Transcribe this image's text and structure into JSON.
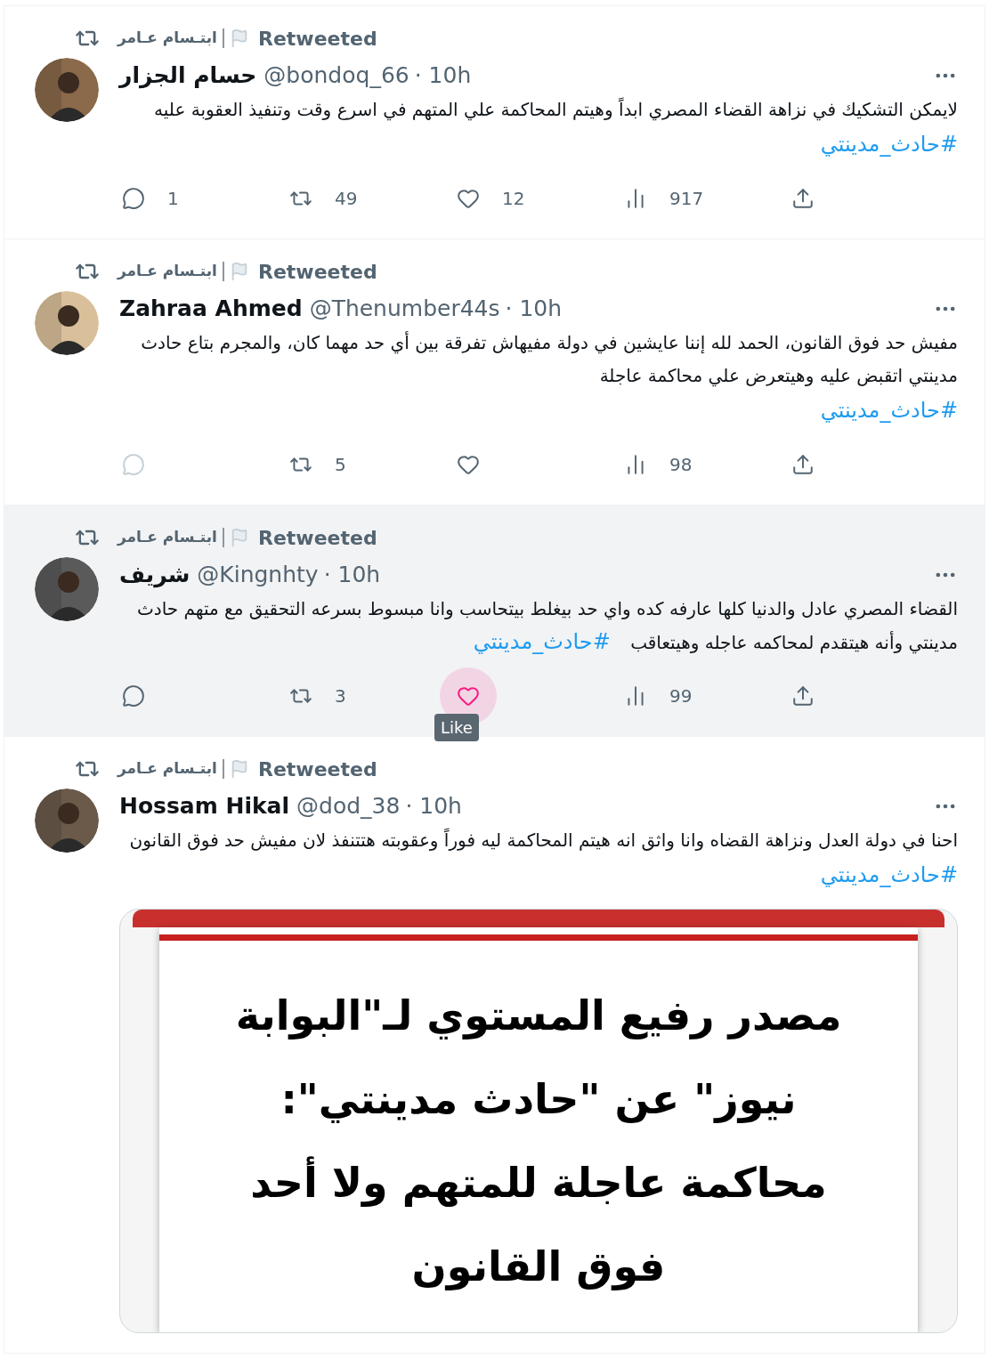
{
  "tweets": [
    {
      "retweeted_by": "ابتـسام عـامر",
      "retweet_label": "Retweeted",
      "name": "حسام الجزار",
      "handle": "@bondoq_66",
      "time": "· 10h",
      "text": "لايمكن التشكيك في نزاهة القضاء المصري ابداً وهيتم المحاكمة علي المتهم في اسرع وقت وتنفيذ العقوبة عليه",
      "hashtag": "#حادث_مدينتي",
      "hashtag_inline": false,
      "highlighted": false,
      "actions": {
        "reply": {
          "count": "1",
          "disabled": false,
          "hovered": false
        },
        "retweet": {
          "count": "49",
          "disabled": false,
          "hovered": false
        },
        "like": {
          "count": "12",
          "disabled": false,
          "hovered": false
        },
        "views": {
          "count": "917",
          "disabled": false,
          "hovered": false
        },
        "share": {
          "disabled": false,
          "hovered": false
        }
      }
    },
    {
      "retweeted_by": "ابتـسام عـامر",
      "retweet_label": "Retweeted",
      "name": "Zahraa Ahmed",
      "handle": "@Thenumber44s",
      "time": "· 10h",
      "text": "مفيش حد فوق القانون، الحمد لله إننا عايشين في دولة مفيهاش تفرقة بين أي حد مهما كان، والمجرم بتاع حادث مدينتي اتقبض عليه وهيتعرض علي محاكمة عاجلة",
      "hashtag": "#حادث_مدينتي",
      "hashtag_inline": false,
      "highlighted": false,
      "actions": {
        "reply": {
          "disabled": true,
          "hovered": false
        },
        "retweet": {
          "count": "5",
          "disabled": false,
          "hovered": false
        },
        "like": {
          "disabled": false,
          "hovered": false
        },
        "views": {
          "count": "98",
          "disabled": false,
          "hovered": false
        },
        "share": {
          "disabled": false,
          "hovered": false
        }
      }
    },
    {
      "retweeted_by": "ابتـسام عـامر",
      "retweet_label": "Retweeted",
      "name": "شريف",
      "handle": "@Kingnhty",
      "time": "· 10h",
      "text": "القضاء المصري عادل والدنيا كلها عارفه كده واي حد بيغلط بيتحاسب وانا مبسوط بسرعه التحقيق مع متهم حادث مدينتي وأنه هيتقدم لمحاكمه عاجله وهيتعاقب",
      "hashtag": "#حادث_مدينتي",
      "hashtag_inline": true,
      "highlighted": true,
      "actions": {
        "reply": {
          "disabled": false,
          "hovered": false
        },
        "retweet": {
          "count": "3",
          "disabled": false,
          "hovered": false
        },
        "like": {
          "disabled": false,
          "hovered": true,
          "tooltip": "Like"
        },
        "views": {
          "count": "99",
          "disabled": false,
          "hovered": false
        },
        "share": {
          "disabled": false,
          "hovered": false
        }
      }
    },
    {
      "retweeted_by": "ابتـسام عـامر",
      "retweet_label": "Retweeted",
      "name": "Hossam Hikal",
      "handle": "@dod_38",
      "time": "· 10h",
      "text": "احنا في دولة العدل ونزاهة القضاه وانا واثق انه هيتم المحاكمة ليه فوراً وعقوبته هتتنفذ لان مفيش حد فوق القانون",
      "hashtag": "#حادث_مدينتي",
      "hashtag_inline": false,
      "highlighted": false,
      "media": {
        "lines": [
          "مصدر رفيع المستوي لـ\"البوابة",
          "نيوز\" عن \"حادث مدينتي\":",
          "محاكمة عاجلة للمتهم ولا أحد",
          "فوق القانون"
        ]
      }
    }
  ]
}
